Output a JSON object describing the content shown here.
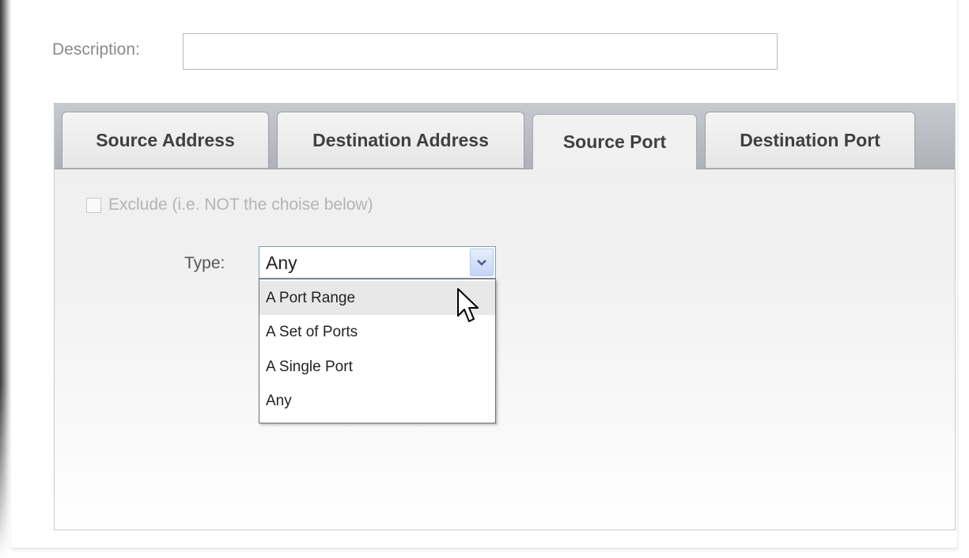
{
  "form": {
    "description_label": "Description:",
    "description_value": ""
  },
  "tabs": [
    {
      "label": "Source Address"
    },
    {
      "label": "Destination Address"
    },
    {
      "label": "Source Port"
    },
    {
      "label": "Destination Port"
    }
  ],
  "active_tab": "Source Port",
  "exclude": {
    "label": "Exclude (i.e. NOT the choise below)",
    "checked": false
  },
  "type_select": {
    "label": "Type:",
    "value": "Any",
    "options": [
      {
        "label": "A Port Range"
      },
      {
        "label": "A Set of Ports"
      },
      {
        "label": "A Single Port"
      },
      {
        "label": "Any"
      }
    ],
    "highlighted": "A Port Range"
  },
  "icons": {
    "dropdown": "chevron-down-icon",
    "pointer": "mouse-pointer-icon"
  }
}
